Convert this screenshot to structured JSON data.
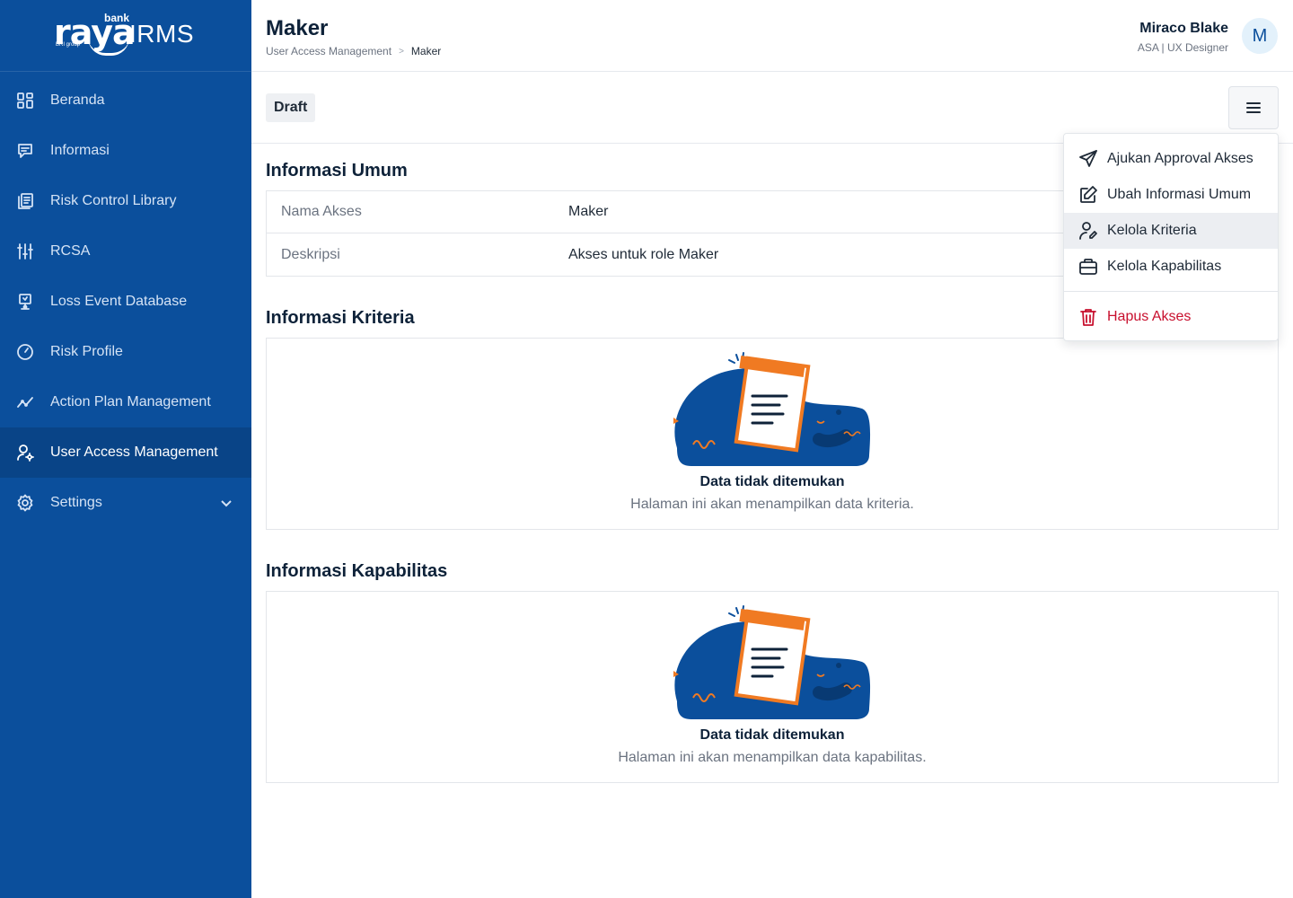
{
  "brand": {
    "name": "raya",
    "product": "IRMS",
    "tagline": "bank",
    "group": "BRI group"
  },
  "colors": {
    "sidebar_bg": "#0b4f9c",
    "accent": "#0b4f9c",
    "danger": "#c8102e",
    "illustration_orange": "#f07a22"
  },
  "sidebar": {
    "items": [
      {
        "label": "Beranda",
        "icon": "grid-icon"
      },
      {
        "label": "Informasi",
        "icon": "message-icon"
      },
      {
        "label": "Risk Control Library",
        "icon": "library-icon"
      },
      {
        "label": "RCSA",
        "icon": "sliders-icon"
      },
      {
        "label": "Loss Event Database",
        "icon": "presentation-icon"
      },
      {
        "label": "Risk Profile",
        "icon": "gauge-icon"
      },
      {
        "label": "Action Plan Management",
        "icon": "trend-icon"
      },
      {
        "label": "User Access Management",
        "icon": "user-gear-icon",
        "active": true
      },
      {
        "label": "Settings",
        "icon": "gear-icon"
      }
    ]
  },
  "header": {
    "title": "Maker",
    "breadcrumb": [
      "User Access Management",
      "Maker"
    ],
    "breadcrumb_separator": ">",
    "user": {
      "name": "Miraco Blake",
      "role": "ASA | UX Designer",
      "initial": "M"
    }
  },
  "toolbar": {
    "status": "Draft"
  },
  "general_info": {
    "title": "Informasi Umum",
    "rows": [
      {
        "key": "Nama Akses",
        "value": "Maker"
      },
      {
        "key": "Deskripsi",
        "value": "Akses untuk role Maker"
      }
    ]
  },
  "criteria": {
    "title": "Informasi Kriteria",
    "empty_title": "Data tidak ditemukan",
    "empty_desc": "Halaman ini akan menampilkan data kriteria."
  },
  "capabilities": {
    "title": "Informasi Kapabilitas",
    "empty_title": "Data tidak ditemukan",
    "empty_desc": "Halaman ini akan menampilkan data kapabilitas."
  },
  "dropdown": {
    "items": [
      {
        "label": "Ajukan Approval Akses",
        "icon": "send-icon"
      },
      {
        "label": "Ubah Informasi Umum",
        "icon": "edit-icon"
      },
      {
        "label": "Kelola Kriteria",
        "icon": "user-edit-icon",
        "hovered": true
      },
      {
        "label": "Kelola Kapabilitas",
        "icon": "briefcase-icon"
      }
    ],
    "danger_item": {
      "label": "Hapus Akses",
      "icon": "trash-icon"
    }
  }
}
